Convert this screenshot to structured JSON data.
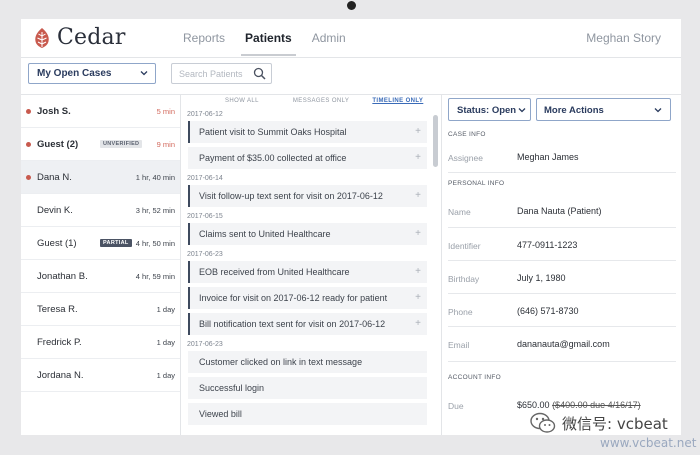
{
  "app": {
    "logo_text": "Cedar",
    "logo_icon": "cedar-leaf-icon",
    "brand_color": "#c85a4e",
    "nav": [
      "Reports",
      "Patients",
      "Admin"
    ],
    "active_nav": "Patients",
    "user_name": "Meghan Story"
  },
  "filters": {
    "case_filter": "My Open Cases",
    "search_placeholder": "Search Patients"
  },
  "patients": [
    {
      "name": "Josh S.",
      "time": "5 min",
      "alert": true,
      "dot": true,
      "badge": ""
    },
    {
      "name": "Guest (2)",
      "time": "9 min",
      "alert": true,
      "dot": true,
      "badge": "UNVERIFIED"
    },
    {
      "name": "Dana N.",
      "time": "1 hr, 40 min",
      "alert": false,
      "dot": true,
      "badge": ""
    },
    {
      "name": "Devin K.",
      "time": "3 hr, 52 min",
      "alert": false,
      "dot": false,
      "badge": ""
    },
    {
      "name": "Guest (1)",
      "time": "4 hr, 50 min",
      "alert": false,
      "dot": false,
      "badge": "PARTIAL"
    },
    {
      "name": "Jonathan B.",
      "time": "4 hr, 59 min",
      "alert": false,
      "dot": false,
      "badge": ""
    },
    {
      "name": "Teresa R.",
      "time": "1 day",
      "alert": false,
      "dot": false,
      "badge": ""
    },
    {
      "name": "Fredrick P.",
      "time": "1 day",
      "alert": false,
      "dot": false,
      "badge": ""
    },
    {
      "name": "Jordana N.",
      "time": "1 day",
      "alert": false,
      "dot": false,
      "badge": ""
    }
  ],
  "timeline": {
    "tabs": [
      "SHOW ALL",
      "MESSAGES ONLY",
      "TIMELINE ONLY"
    ],
    "active_tab": "TIMELINE ONLY",
    "groups": [
      {
        "date": "2017-06-12",
        "items": [
          {
            "text": "Patient visit to Summit Oaks Hospital",
            "bar": true,
            "plus": true
          },
          {
            "text": "Payment of $35.00 collected at office",
            "bar": false,
            "plus": true
          }
        ]
      },
      {
        "date": "2017-06-14",
        "items": [
          {
            "text": "Visit follow-up text sent for visit on 2017-06-12",
            "bar": true,
            "plus": true
          }
        ]
      },
      {
        "date": "2017-06-15",
        "items": [
          {
            "text": "Claims sent to United Healthcare",
            "bar": true,
            "plus": true
          }
        ]
      },
      {
        "date": "2017-06-23",
        "items": [
          {
            "text": "EOB received from United Healthcare",
            "bar": true,
            "plus": true
          },
          {
            "text": "Invoice for visit on 2017-06-12 ready for patient",
            "bar": true,
            "plus": true
          },
          {
            "text": "Bill notification text sent for visit on 2017-06-12",
            "bar": true,
            "plus": true
          }
        ]
      },
      {
        "date": "2017-06-23",
        "items": [
          {
            "text": "Customer clicked on link in text message",
            "bar": false,
            "plus": false
          },
          {
            "text": "Successful login",
            "bar": false,
            "plus": false
          },
          {
            "text": "Viewed bill",
            "bar": false,
            "plus": false
          }
        ]
      }
    ]
  },
  "detail": {
    "status": "Status: Open",
    "more_actions": "More Actions",
    "case_info_title": "CASE INFO",
    "assignee_label": "Assignee",
    "assignee": "Meghan James",
    "personal_info_title": "PERSONAL INFO",
    "name_label": "Name",
    "name": "Dana Nauta (Patient)",
    "identifier_label": "Identifier",
    "identifier": "477-0911-1223",
    "birthday_label": "Birthday",
    "birthday": "July 1, 1980",
    "phone_label": "Phone",
    "phone": "(646) 571-8730",
    "email_label": "Email",
    "email": "dananauta@gmail.com",
    "account_info_title": "ACCOUNT INFO",
    "due_label": "Due",
    "due_amount": "$650.00",
    "due_note": "($400.00 due 4/16/17)"
  },
  "watermark": {
    "text": "微信号: vcbeat",
    "url": "www.vcbeat.net"
  }
}
